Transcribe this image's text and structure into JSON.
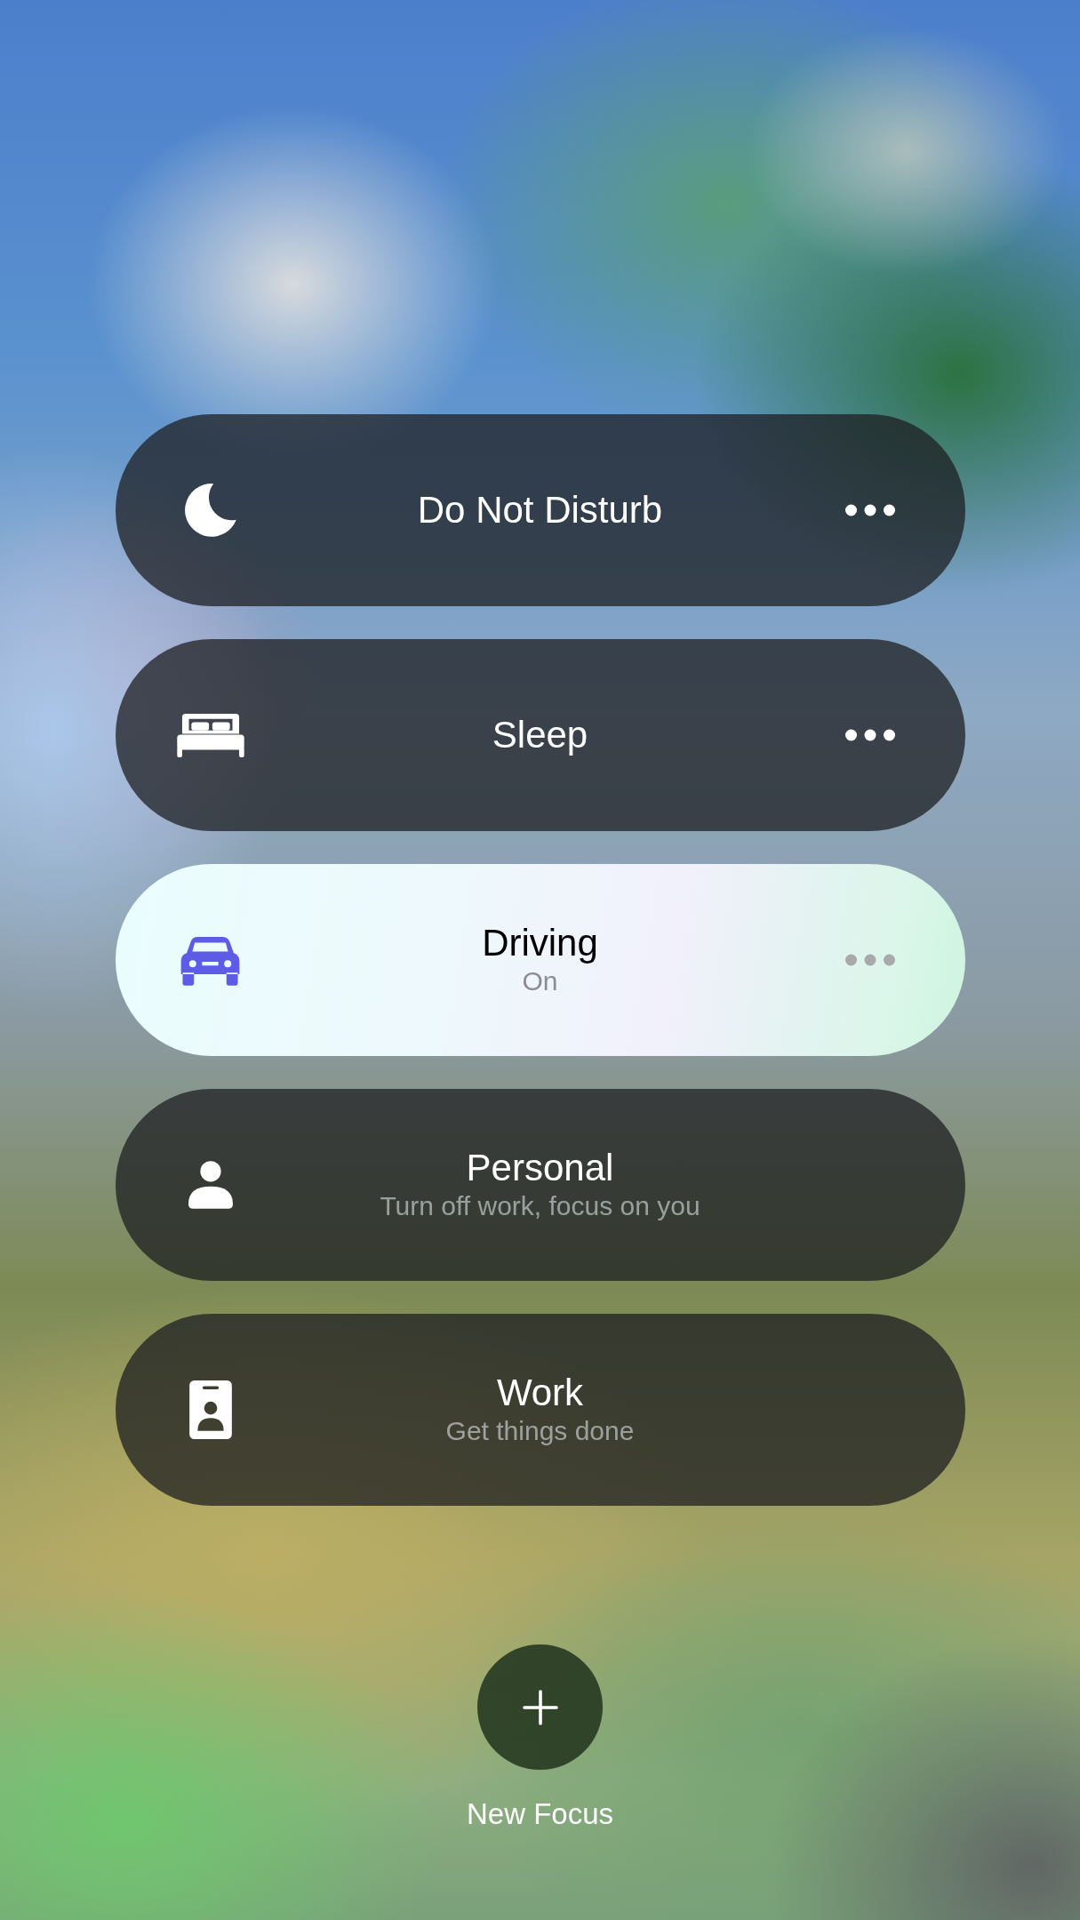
{
  "focus_modes": [
    {
      "kind": "moon",
      "title": "Do Not Disturb",
      "selected": false,
      "options": true
    },
    {
      "kind": "bed",
      "title": "Sleep",
      "selected": false,
      "options": true
    },
    {
      "kind": "car",
      "title": "Driving",
      "subtitle": "On",
      "selected": true,
      "options": true
    },
    {
      "kind": "person",
      "title": "Personal",
      "subtitle": "Turn off work, focus on you",
      "selected": false,
      "options": false
    },
    {
      "kind": "badge",
      "title": "Work",
      "subtitle": "Get things done",
      "selected": false,
      "options": false
    }
  ],
  "new_focus": {
    "label": "New Focus"
  }
}
